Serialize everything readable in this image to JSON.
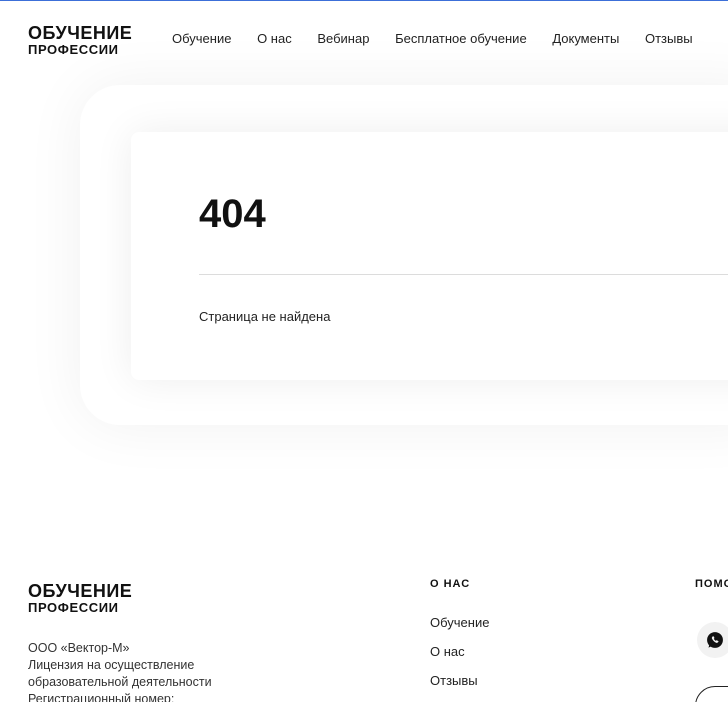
{
  "header": {
    "logo_line1": "ОБУЧЕНИЕ",
    "logo_line2": "ПРОФЕССИИ",
    "nav": [
      "Обучение",
      "О нас",
      "Вебинар",
      "Бесплатное обучение",
      "Документы",
      "Отзывы"
    ]
  },
  "error": {
    "code": "404",
    "message": "Страница не найдена"
  },
  "footer": {
    "logo_line1": "ОБУЧЕНИЕ",
    "logo_line2": "ПРОФЕССИИ",
    "company_lines": [
      "ООО «Вектор-М»",
      "Лицензия на осуществление",
      "образовательной деятельности",
      "Регистрационный номер:"
    ],
    "about_title": "О НАС",
    "about_links": [
      "Обучение",
      "О нас",
      "Отзывы"
    ],
    "help_title": "ПОМОЩЬ",
    "whatsapp_icon": "whatsapp-icon"
  },
  "colors": {
    "accent_border": "#3c6fd8",
    "text": "#111111"
  }
}
